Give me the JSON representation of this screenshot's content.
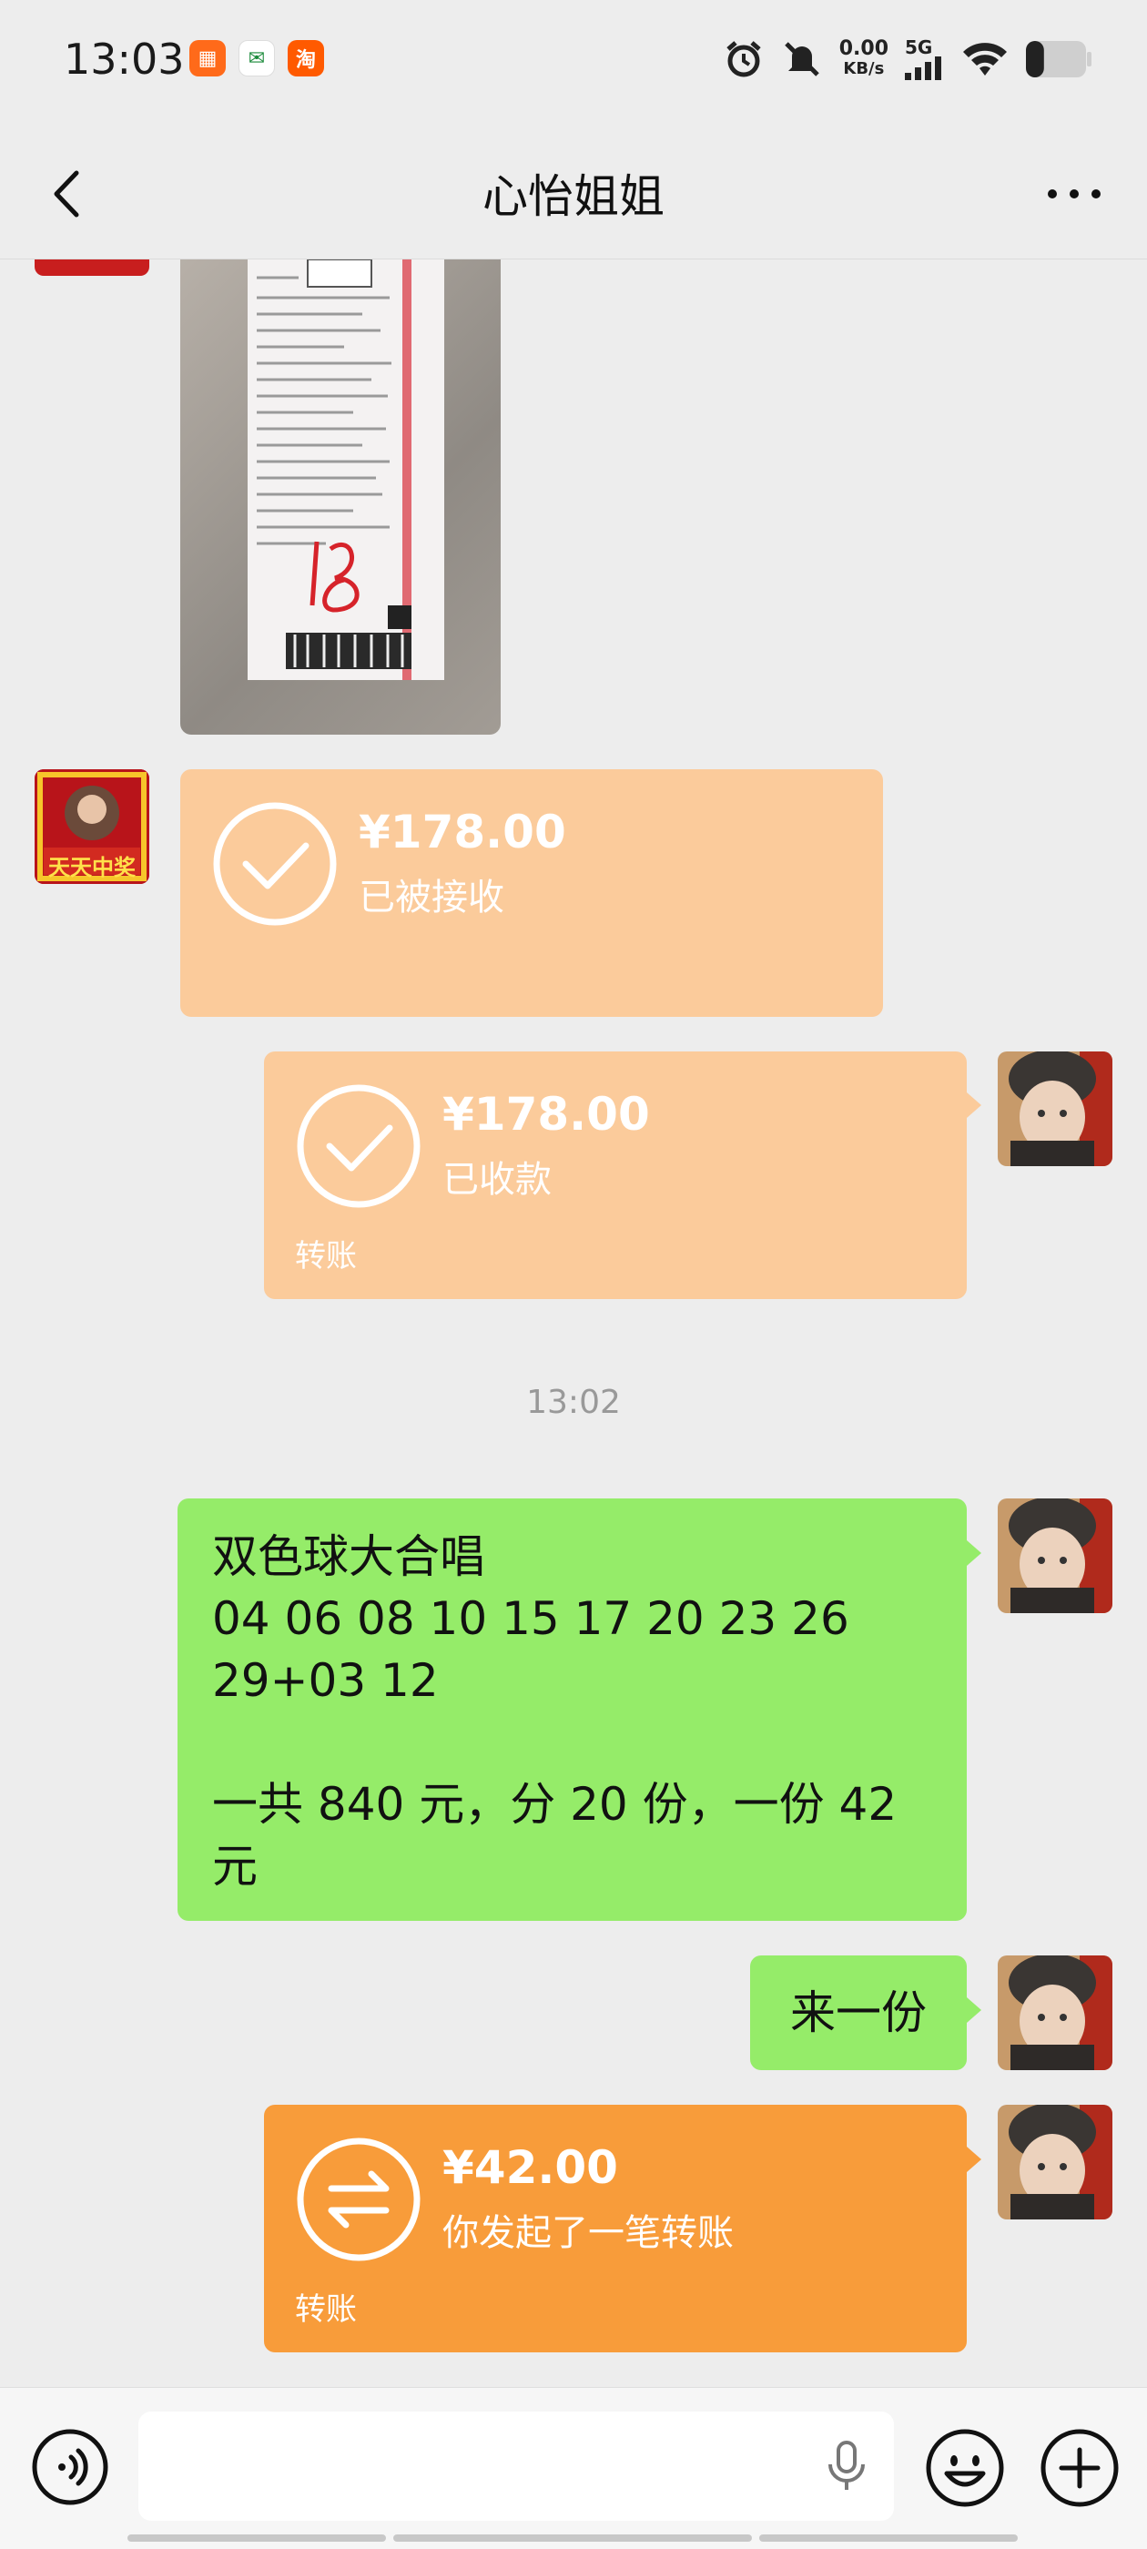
{
  "status_bar": {
    "time": "13:03",
    "app_icons": [
      "taobao-live-icon",
      "post-icon",
      "taobao-icon"
    ],
    "net_speed_value": "0.00",
    "net_speed_unit": "KB/s",
    "network": "5G",
    "battery_level": 0.3
  },
  "header": {
    "title": "心怡姐姐"
  },
  "messages": {
    "transfer_received": {
      "amount": "¥178.00",
      "status": "已被接收"
    },
    "transfer_collected": {
      "amount": "¥178.00",
      "status": "已收款",
      "footer": "转账"
    },
    "timestamp": "13:02",
    "text_lottery": "双色球大合唱\n04 06 08 10 15 17 20 23 26\n29+03 12\n\n一共 840 元，分 20 份，一份 42\n元",
    "text_short": "来一份",
    "transfer_sent": {
      "amount": "¥42.00",
      "status": "你发起了一笔转账",
      "footer": "转账"
    }
  },
  "colors": {
    "green_bubble": "#95ec69",
    "transfer_done": "#fbcb9b",
    "transfer_active": "#f89c3a"
  },
  "avatar_badge": "天天中奖"
}
